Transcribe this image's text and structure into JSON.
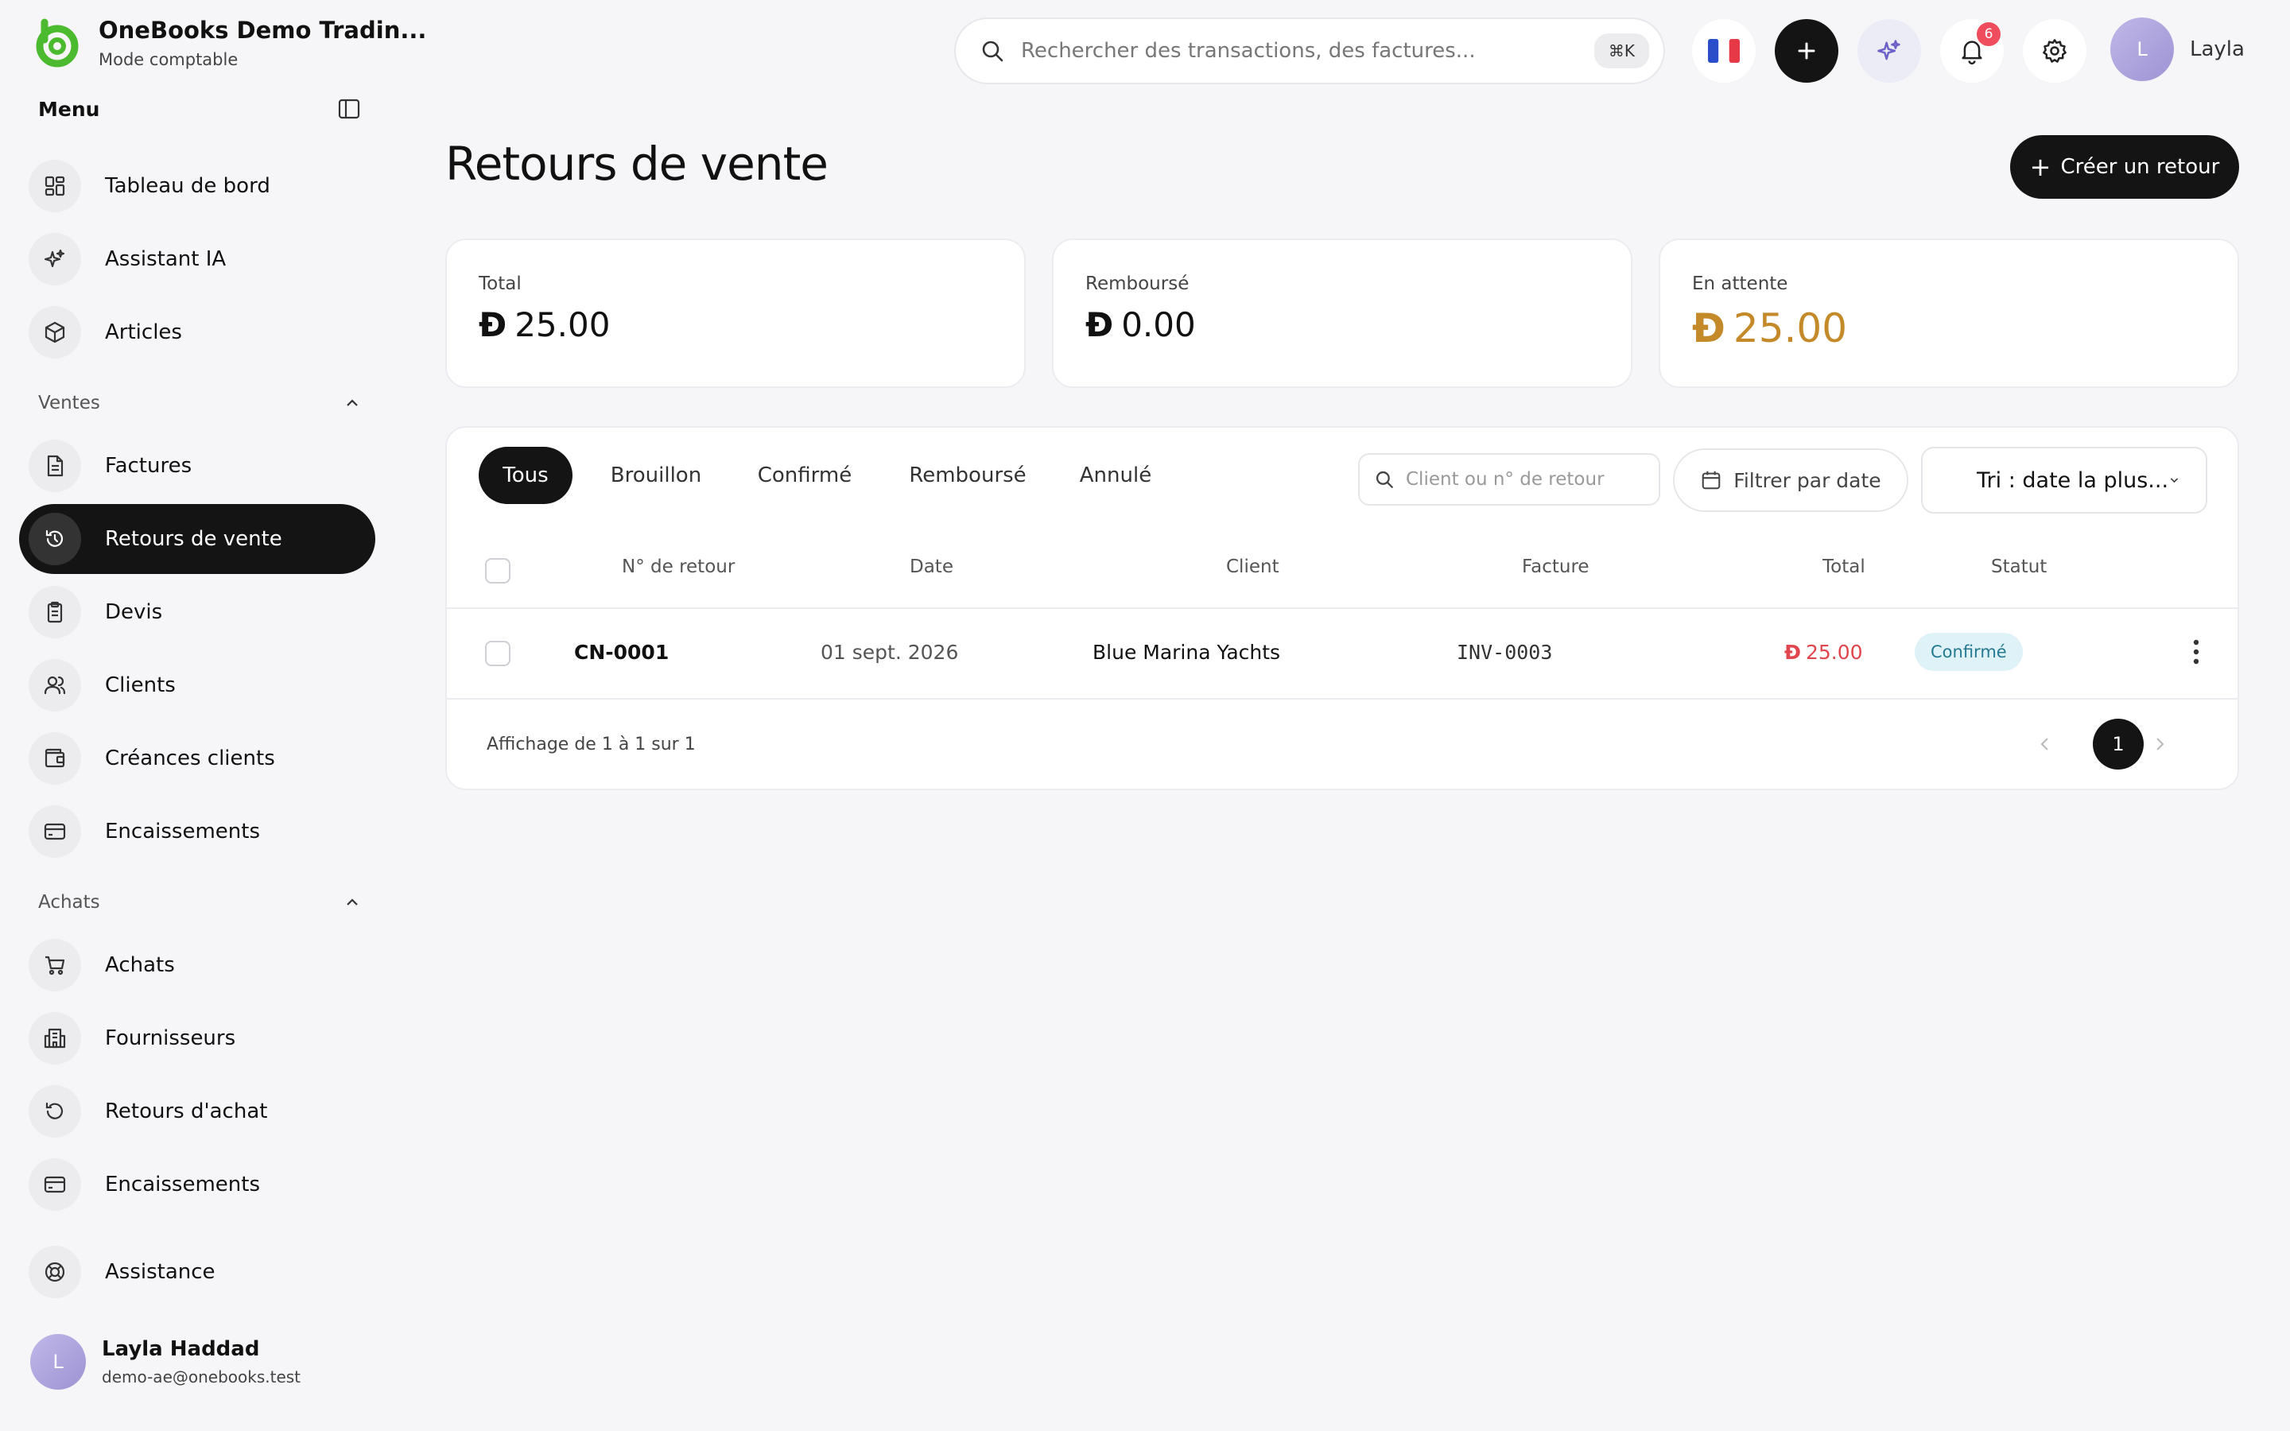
{
  "brand": {
    "name": "OneBooks Demo Tradin...",
    "mode": "Mode comptable"
  },
  "sidebar": {
    "menu_title": "Menu",
    "items_top": [
      {
        "label": "Tableau de bord",
        "icon": "dashboard-icon"
      },
      {
        "label": "Assistant IA",
        "icon": "sparkle-icon"
      },
      {
        "label": "Articles",
        "icon": "box-icon"
      }
    ],
    "sections": [
      {
        "label": "Ventes",
        "items": [
          {
            "label": "Factures",
            "icon": "invoice-icon"
          },
          {
            "label": "Retours de vente",
            "icon": "return-icon",
            "active": true
          },
          {
            "label": "Devis",
            "icon": "quote-icon"
          },
          {
            "label": "Clients",
            "icon": "users-icon"
          },
          {
            "label": "Créances clients",
            "icon": "wallet-icon"
          },
          {
            "label": "Encaissements",
            "icon": "card-icon"
          }
        ]
      },
      {
        "label": "Achats",
        "items": [
          {
            "label": "Achats",
            "icon": "cart-icon"
          },
          {
            "label": "Fournisseurs",
            "icon": "building-icon"
          },
          {
            "label": "Retours d'achat",
            "icon": "return-icon"
          },
          {
            "label": "Encaissements",
            "icon": "card-icon"
          }
        ]
      }
    ],
    "support": {
      "label": "Assistance",
      "icon": "lifebuoy-icon"
    },
    "user": {
      "initial": "L",
      "name": "Layla Haddad",
      "email": "demo-ae@onebooks.test"
    }
  },
  "topbar": {
    "search_placeholder": "Rechercher des transactions, des factures...",
    "shortcut": "⌘K",
    "notifications_count": "6",
    "user_initial": "L",
    "user_name": "Layla"
  },
  "page": {
    "title": "Retours de vente",
    "create_label": "Créer un retour",
    "currency_symbol": "Đ"
  },
  "stats": [
    {
      "label": "Total",
      "value": "25.00"
    },
    {
      "label": "Remboursé",
      "value": "0.00"
    },
    {
      "label": "En attente",
      "value": "25.00"
    }
  ],
  "tabs": [
    "Tous",
    "Brouillon",
    "Confirmé",
    "Remboursé",
    "Annulé"
  ],
  "filters": {
    "client_placeholder": "Client ou n° de retour",
    "date_label": "Filtrer par date",
    "sort_label": "Tri : date la plus..."
  },
  "table": {
    "headers": [
      "N° de retour",
      "Date",
      "Client",
      "Facture",
      "Total",
      "Statut"
    ],
    "rows": [
      {
        "number": "CN-0001",
        "date": "01 sept. 2026",
        "client": "Blue Marina Yachts",
        "invoice": "INV-0003",
        "total": "25.00",
        "status": "Confirmé"
      }
    ]
  },
  "pagination": {
    "summary": "Affichage de 1 à 1 sur 1",
    "current": "1"
  },
  "colors": {
    "accent_dark": "#141414",
    "brand_green": "#4cba2f",
    "pending_amount": "#c48a2a",
    "negative_amount": "#e0464e",
    "status_confirmed_bg": "#dff2f7",
    "notification_badge": "#ef4c5d"
  }
}
